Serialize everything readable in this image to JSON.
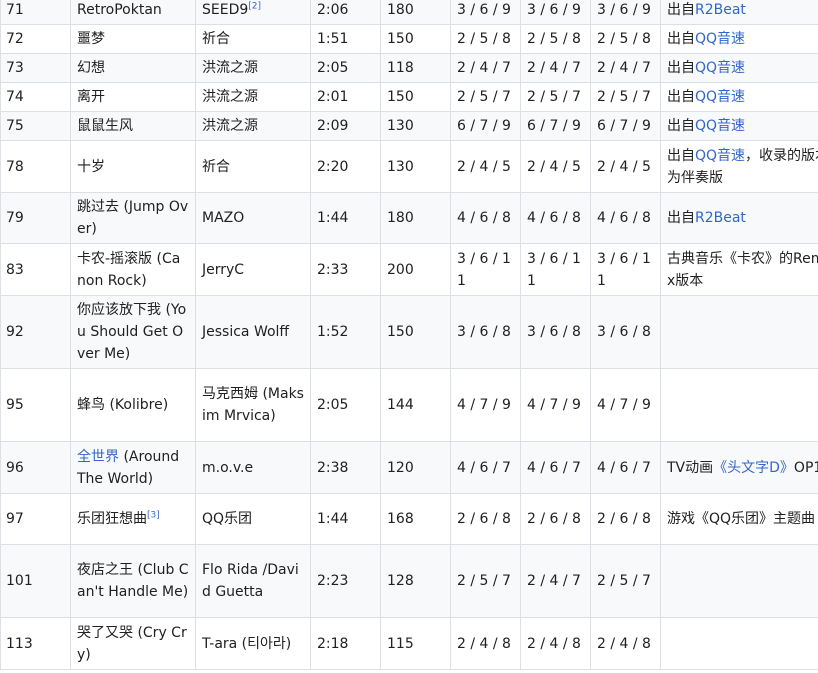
{
  "rows": [
    {
      "no": "71",
      "title": "RetroPoktan",
      "artist": "SEED9",
      "artist_sup": "[2]",
      "time": "2:06",
      "bpm": "180",
      "d1": "3 / 6 / 9",
      "d2": "3 / 6 / 9",
      "d3": "3 / 6 / 9",
      "note_pre": "出自",
      "note_link": "R2Beat",
      "note_post": ""
    },
    {
      "no": "72",
      "title": "噩梦",
      "artist": "祈合",
      "time": "1:51",
      "bpm": "150",
      "d1": "2 / 5 / 8",
      "d2": "2 / 5 / 8",
      "d3": "2 / 5 / 8",
      "note_pre": "出自",
      "note_link": "QQ音速",
      "note_post": ""
    },
    {
      "no": "73",
      "title": "幻想",
      "artist": "洪流之源",
      "time": "2:05",
      "bpm": "118",
      "d1": "2 / 4 / 7",
      "d2": "2 / 4 / 7",
      "d3": "2 / 4 / 7",
      "note_pre": "出自",
      "note_link": "QQ音速",
      "note_post": ""
    },
    {
      "no": "74",
      "title": "离开",
      "artist": "洪流之源",
      "time": "2:01",
      "bpm": "150",
      "d1": "2 / 5 / 7",
      "d2": "2 / 5 / 7",
      "d3": "2 / 5 / 7",
      "note_pre": "出自",
      "note_link": "QQ音速",
      "note_post": ""
    },
    {
      "no": "75",
      "title": "鼠鼠生风",
      "artist": "洪流之源",
      "time": "2:09",
      "bpm": "130",
      "d1": "6 / 7 / 9",
      "d2": "6 / 7 / 9",
      "d3": "6 / 7 / 9",
      "note_pre": "出自",
      "note_link": "QQ音速",
      "note_post": ""
    },
    {
      "no": "78",
      "title": "十岁",
      "artist": "祈合",
      "time": "2:20",
      "bpm": "130",
      "d1": "2 / 4 / 5",
      "d2": "2 / 4 / 5",
      "d3": "2 / 4 / 5",
      "note_pre": "出自",
      "note_link": "QQ音速",
      "note_post": "，收录的版本为伴奏版"
    },
    {
      "no": "79",
      "title": "跳过去 (Jump Over)",
      "artist": "MAZO",
      "time": "1:44",
      "bpm": "180",
      "d1": "4 / 6 / 8",
      "d2": "4 / 6 / 8",
      "d3": "4 / 6 / 8",
      "note_pre": "出自",
      "note_link": "R2Beat",
      "note_post": ""
    },
    {
      "no": "83",
      "title": "卡农-摇滚版 (Canon Rock)",
      "artist": "JerryC",
      "time": "2:33",
      "bpm": "200",
      "d1": "3 / 6 / 11",
      "d2": "3 / 6 / 11",
      "d3": "3 / 6 / 11",
      "note_pre": "古典音乐《卡农》的Remix版本",
      "note_link": "",
      "note_post": ""
    },
    {
      "no": "92",
      "title": "你应该放下我 (You Should Get Over Me)",
      "artist": "Jessica Wolff",
      "time": "1:52",
      "bpm": "150",
      "d1": "3 / 6 / 8",
      "d2": "3 / 6 / 8",
      "d3": "3 / 6 / 8",
      "note_pre": "",
      "note_link": "",
      "note_post": ""
    },
    {
      "no": "95",
      "title": "蜂鸟 (Kolibre)",
      "artist": "马克西姆 (Maksim Mrvica)",
      "time": "2:05",
      "bpm": "144",
      "d1": "4 / 7 / 9",
      "d2": "4 / 7 / 9",
      "d3": "4 / 7 / 9",
      "note_pre": "",
      "note_link": "",
      "note_post": ""
    },
    {
      "no": "96",
      "title_link": "全世界",
      "title": " (Around The World)",
      "artist": "m.o.v.e",
      "time": "2:38",
      "bpm": "120",
      "d1": "4 / 6 / 7",
      "d2": "4 / 6 / 7",
      "d3": "4 / 6 / 7",
      "note_pre": "TV动画",
      "note_link": "《头文字D》",
      "note_post": "OP1"
    },
    {
      "no": "97",
      "title": "乐团狂想曲",
      "title_sup": "[3]",
      "artist": "QQ乐团",
      "time": "1:44",
      "bpm": "168",
      "d1": "2 / 6 / 8",
      "d2": "2 / 6 / 8",
      "d3": "2 / 6 / 8",
      "note_pre": "游戏《QQ乐团》主题曲",
      "note_link": "",
      "note_post": ""
    },
    {
      "no": "101",
      "title": "夜店之王 (Club Can't Handle Me)",
      "artist": "Flo Rida /David Guetta",
      "time": "2:23",
      "bpm": "128",
      "d1": "2 / 5 / 7",
      "d2": "2 / 4 / 7",
      "d3": "2 / 5 / 7",
      "note_pre": "",
      "note_link": "",
      "note_post": ""
    },
    {
      "no": "113",
      "title": "哭了又哭 (Cry Cry)",
      "artist": "T-ara (티아라)",
      "time": "2:18",
      "bpm": "115",
      "d1": "2 / 4 / 8",
      "d2": "2 / 4 / 8",
      "d3": "2 / 4 / 8",
      "note_pre": "",
      "note_link": "",
      "note_post": ""
    }
  ]
}
